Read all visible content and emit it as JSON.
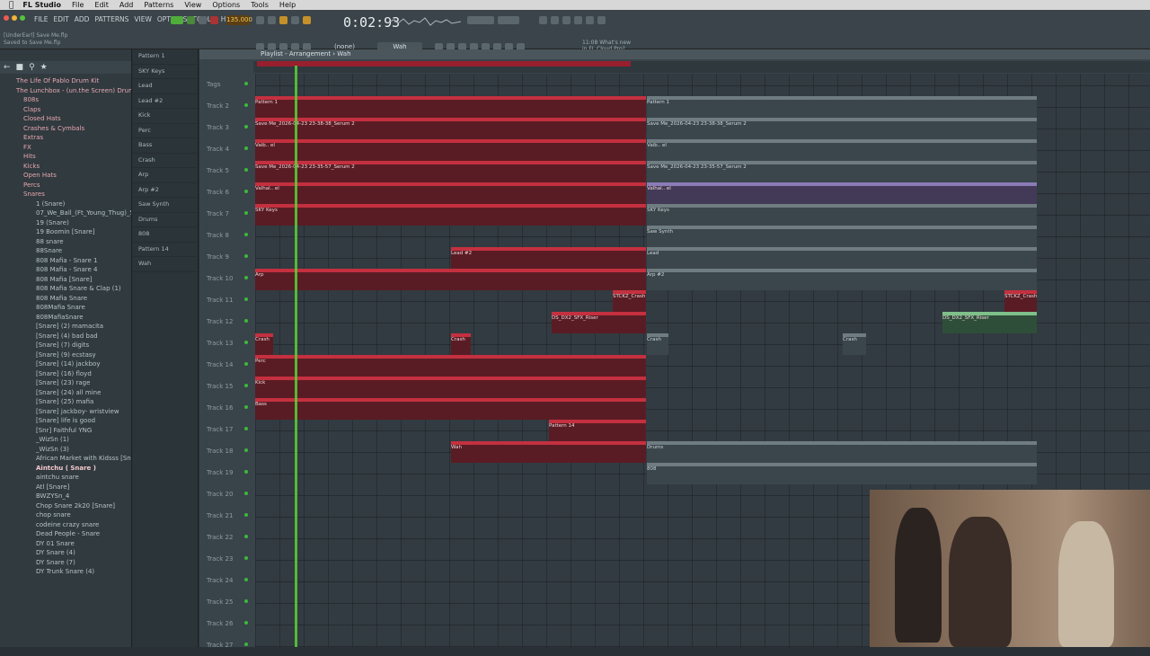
{
  "menubar": {
    "app": "FL Studio",
    "items": [
      "File",
      "Edit",
      "Add",
      "Patterns",
      "View",
      "Options",
      "Tools",
      "Help"
    ]
  },
  "toolbar": {
    "menu": [
      "FILE",
      "EDIT",
      "ADD",
      "PATTERNS",
      "VIEW",
      "OPTIONS",
      "TOOLS",
      "HELP"
    ],
    "hint_line1": "[UnderEarl] Save Me.flp",
    "hint_line2": "Saved to Save Me.flp",
    "tempo": "135.000",
    "time": "0:02:93",
    "snap": "(none)",
    "pattern": "Wah",
    "cloud_line1": "11:08 What's new",
    "cloud_line2": "in FL Cloud Pro?"
  },
  "browser": {
    "items": [
      {
        "label": "The Life Of Pablo Drum Kit",
        "type": "folder"
      },
      {
        "label": "The Lunchbox - (un.the Screen) Drumkit",
        "type": "folder"
      },
      {
        "label": "808s",
        "type": "folder"
      },
      {
        "label": "Claps",
        "type": "folder"
      },
      {
        "label": "Closed Hats",
        "type": "folder"
      },
      {
        "label": "Crashes & Cymbals",
        "type": "folder"
      },
      {
        "label": "Extras",
        "type": "folder"
      },
      {
        "label": "FX",
        "type": "folder"
      },
      {
        "label": "Hits",
        "type": "folder"
      },
      {
        "label": "Kicks",
        "type": "folder"
      },
      {
        "label": "Open Hats",
        "type": "folder"
      },
      {
        "label": "Percs",
        "type": "folder"
      },
      {
        "label": "Snares",
        "type": "folder"
      },
      {
        "label": "1 (Snare)",
        "type": "file"
      },
      {
        "label": "07_We_Ball_(Ft_Young_Thug)_5",
        "type": "file"
      },
      {
        "label": "19 (Snare)",
        "type": "file"
      },
      {
        "label": "19 Boomin [Snare]",
        "type": "file"
      },
      {
        "label": "88 snare",
        "type": "file"
      },
      {
        "label": "88Snare",
        "type": "file"
      },
      {
        "label": "808 Mafia - Snare 1",
        "type": "file"
      },
      {
        "label": "808 Mafia - Snare 4",
        "type": "file"
      },
      {
        "label": "808 Mafia [Snare]",
        "type": "file"
      },
      {
        "label": "808 Mafia Snare & Clap (1)",
        "type": "file"
      },
      {
        "label": "808 Mafia Snare",
        "type": "file"
      },
      {
        "label": "808Mafia Snare",
        "type": "file"
      },
      {
        "label": "808MafiaSnare",
        "type": "file"
      },
      {
        "label": "[Snare] (2) mamacita",
        "type": "file"
      },
      {
        "label": "[Snare] (4) bad bad",
        "type": "file"
      },
      {
        "label": "[Snare] (7) digits",
        "type": "file"
      },
      {
        "label": "[Snare] (9) ecstasy",
        "type": "file"
      },
      {
        "label": "[Snare] (14) jackboy",
        "type": "file"
      },
      {
        "label": "[Snare] (16) floyd",
        "type": "file"
      },
      {
        "label": "[Snare] (23) rage",
        "type": "file"
      },
      {
        "label": "[Snare] (24) all mine",
        "type": "file"
      },
      {
        "label": "[Snare] (25) mafia",
        "type": "file"
      },
      {
        "label": "[Snare] jackboy- wristview",
        "type": "file"
      },
      {
        "label": "[Snare] life is good",
        "type": "file"
      },
      {
        "label": "[Snr] Faithful YNG",
        "type": "file"
      },
      {
        "label": "_WizSn (1)",
        "type": "file"
      },
      {
        "label": "_WizSn (3)",
        "type": "file"
      },
      {
        "label": "African Market with Kidsss [Snare]",
        "type": "file"
      },
      {
        "label": "Aintchu ( Snare )",
        "type": "selected"
      },
      {
        "label": "aintchu snare",
        "type": "file"
      },
      {
        "label": "Atl [Snare]",
        "type": "file"
      },
      {
        "label": "BWZYSn_4",
        "type": "file"
      },
      {
        "label": "Chop Snare 2k20 [Snare]",
        "type": "file"
      },
      {
        "label": "chop snare",
        "type": "file"
      },
      {
        "label": "codeine crazy snare",
        "type": "file"
      },
      {
        "label": "Dead People - Snare",
        "type": "file"
      },
      {
        "label": "DY 01 Snare",
        "type": "file"
      },
      {
        "label": "DY Snare (4)",
        "type": "file"
      },
      {
        "label": "DY Snare (7)",
        "type": "file"
      },
      {
        "label": "DY Trunk Snare (4)",
        "type": "file"
      }
    ]
  },
  "picker": [
    "Pattern 1",
    "SKY Keys",
    "Lead",
    "Lead #2",
    "Kick",
    "Perc",
    "Bass",
    "Crash",
    "Arp",
    "Arp #2",
    "Saw Synth",
    "Drums",
    "808",
    "Pattern 14",
    "Wah"
  ],
  "playlist": {
    "title": "Playlist - Arrangement › Wah",
    "tracks": [
      "Tags",
      "Track 2",
      "Track 3",
      "Track 4",
      "Track 5",
      "Track 6",
      "Track 7",
      "Track 8",
      "Track 9",
      "Track 10",
      "Track 11",
      "Track 12",
      "Track 13",
      "Track 14",
      "Track 15",
      "Track 16",
      "Track 17",
      "Track 18",
      "Track 19",
      "Track 20",
      "Track 21",
      "Track 22",
      "Track 23",
      "Track 24",
      "Track 25",
      "Track 26",
      "Track 27"
    ],
    "clips": [
      {
        "row": 1,
        "start": 0,
        "end": 435,
        "label": "Pattern 1",
        "style": "red"
      },
      {
        "row": 1,
        "start": 436,
        "end": 870,
        "label": "Pattern 1",
        "style": "gray"
      },
      {
        "row": 2,
        "start": 0,
        "end": 435,
        "label": "Save Me_2026-04-23 23-38-38_Serum 2",
        "style": "red"
      },
      {
        "row": 2,
        "start": 436,
        "end": 870,
        "label": "Save Me_2026-04-23 23-38-38_Serum 2",
        "style": "gray"
      },
      {
        "row": 3,
        "start": 0,
        "end": 435,
        "label": "Vaib.. el",
        "style": "red"
      },
      {
        "row": 3,
        "start": 436,
        "end": 870,
        "label": "Vaib.. el",
        "style": "gray"
      },
      {
        "row": 4,
        "start": 0,
        "end": 435,
        "label": "Save Me_2026-04-23 23-35-57_Serum 2",
        "style": "red"
      },
      {
        "row": 4,
        "start": 436,
        "end": 870,
        "label": "Save Me_2026-04-23 23-35-57_Serum 2",
        "style": "gray"
      },
      {
        "row": 5,
        "start": 0,
        "end": 435,
        "label": "Valhal.. el",
        "style": "red"
      },
      {
        "row": 5,
        "start": 436,
        "end": 870,
        "label": "Valhal.. el",
        "style": "violet"
      },
      {
        "row": 6,
        "start": 0,
        "end": 435,
        "label": "SKY Keys",
        "style": "red"
      },
      {
        "row": 6,
        "start": 436,
        "end": 870,
        "label": "SKY Keys",
        "style": "gray"
      },
      {
        "row": 7,
        "start": 436,
        "end": 870,
        "label": "Saw Synth",
        "style": "gray"
      },
      {
        "row": 8,
        "start": 218,
        "end": 435,
        "label": "Lead #2",
        "style": "red"
      },
      {
        "row": 8,
        "start": 436,
        "end": 870,
        "label": "Lead",
        "style": "gray"
      },
      {
        "row": 9,
        "start": 0,
        "end": 435,
        "label": "Arp",
        "style": "red"
      },
      {
        "row": 9,
        "start": 436,
        "end": 870,
        "label": "Arp #2",
        "style": "gray"
      },
      {
        "row": 10,
        "start": 398,
        "end": 435,
        "label": "STCKZ_Crash",
        "style": "red"
      },
      {
        "row": 10,
        "start": 834,
        "end": 870,
        "label": "STCKZ_Crash",
        "style": "red"
      },
      {
        "row": 11,
        "start": 330,
        "end": 435,
        "label": "DS_DX2_SFX_Riser",
        "style": "red"
      },
      {
        "row": 11,
        "start": 765,
        "end": 870,
        "label": "DS_DX2_SFX_Riser",
        "style": "green"
      },
      {
        "row": 12,
        "start": 0,
        "end": 20,
        "label": "Crash",
        "style": "red"
      },
      {
        "row": 12,
        "start": 218,
        "end": 240,
        "label": "Crash",
        "style": "red"
      },
      {
        "row": 12,
        "start": 436,
        "end": 460,
        "label": "Crash",
        "style": "gray"
      },
      {
        "row": 12,
        "start": 654,
        "end": 680,
        "label": "Crash",
        "style": "gray"
      },
      {
        "row": 13,
        "start": 0,
        "end": 435,
        "label": "Perc",
        "style": "red"
      },
      {
        "row": 14,
        "start": 0,
        "end": 435,
        "label": "Kick",
        "style": "red"
      },
      {
        "row": 15,
        "start": 0,
        "end": 435,
        "label": "Bass",
        "style": "red"
      },
      {
        "row": 16,
        "start": 327,
        "end": 435,
        "label": "Pattern 14",
        "style": "red"
      },
      {
        "row": 17,
        "start": 218,
        "end": 435,
        "label": "Wah",
        "style": "red"
      },
      {
        "row": 17,
        "start": 436,
        "end": 870,
        "label": "Drums",
        "style": "gray"
      },
      {
        "row": 18,
        "start": 436,
        "end": 870,
        "label": "808",
        "style": "gray"
      }
    ]
  },
  "colors": {
    "accent": "#c4303f",
    "playhead": "#5bd13a",
    "tempo": "#f5c65a"
  }
}
